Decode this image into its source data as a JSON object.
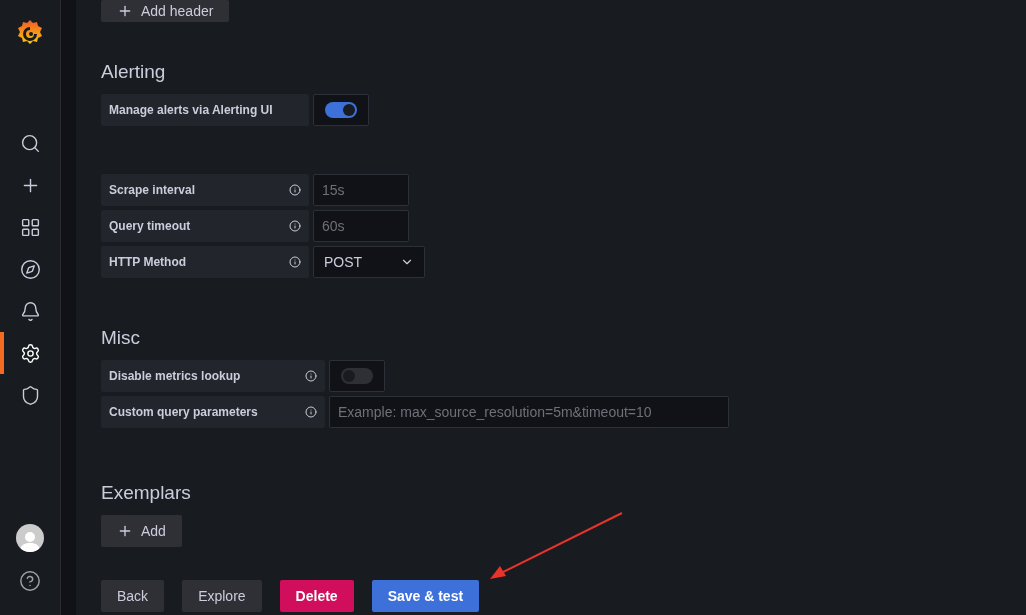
{
  "sidebar": {
    "items": [
      {
        "selected": false
      },
      {
        "selected": false
      },
      {
        "selected": false
      },
      {
        "selected": false
      },
      {
        "selected": false
      },
      {
        "selected": true
      },
      {
        "selected": false
      }
    ]
  },
  "top_button": {
    "label": "Add header"
  },
  "sections": [
    {
      "title": "Alerting",
      "fields": [
        {
          "kind": "switch",
          "label": "Manage alerts via Alerting UI",
          "info": false,
          "on": true
        }
      ]
    },
    {
      "fields": [
        {
          "kind": "input",
          "label": "Scrape interval",
          "info": true,
          "placeholder": "15s"
        },
        {
          "kind": "input",
          "label": "Query timeout",
          "info": true,
          "placeholder": "60s"
        },
        {
          "kind": "select",
          "label": "HTTP Method",
          "info": true,
          "value": "POST"
        }
      ]
    },
    {
      "title": "Misc",
      "fields": [
        {
          "kind": "switch",
          "label": "Disable metrics lookup",
          "info": true,
          "on": false
        },
        {
          "kind": "wide_input",
          "label": "Custom query parameters",
          "info": true,
          "placeholder": "Example: max_source_resolution=5m&timeout=10"
        }
      ]
    },
    {
      "title": "Exemplars",
      "add_button": "Add"
    }
  ],
  "buttons": [
    {
      "label": "Back",
      "kind": "secondary"
    },
    {
      "label": "Explore",
      "kind": "secondary"
    },
    {
      "label": "Delete",
      "kind": "destructive"
    },
    {
      "label": "Save & test",
      "kind": "primary"
    }
  ]
}
